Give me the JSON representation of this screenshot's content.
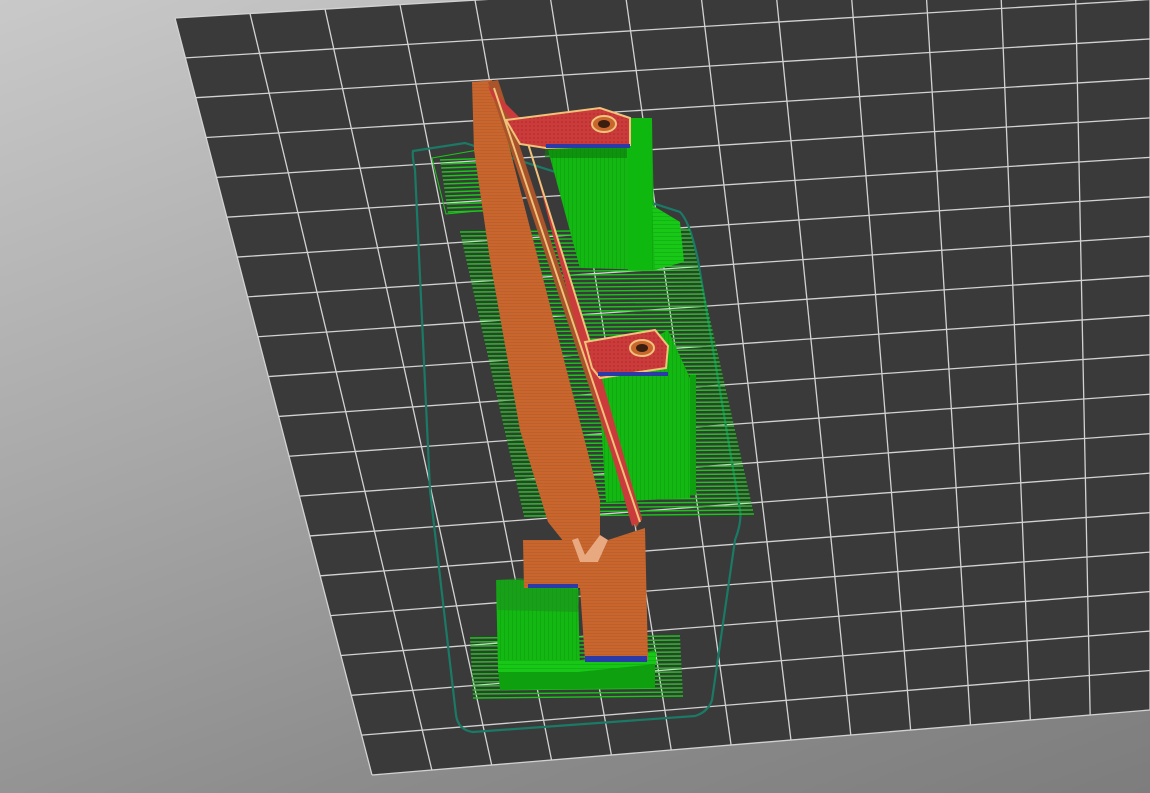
{
  "viewport": {
    "background_top": "#c9c9c9",
    "background_bottom": "#7d7d7d"
  },
  "bed": {
    "fill": "#3a3a3a",
    "grid_line": "#d2d2d2",
    "grid_divisions_u": 13,
    "grid_divisions_v": 19
  },
  "model": {
    "perimeter_color": "#c8662e",
    "perimeter_dark_color": "#a9542a",
    "top_solid_color": "#cc3b3b",
    "top_outline_color": "#f0c27a",
    "support_color": "#17c817",
    "support_dark_color": "#0fa00f",
    "support_interface_color": "#0e7a0e",
    "bridge_color": "#2a3aa8",
    "skirt_color": "#1a7a66",
    "screw_holes": 2
  }
}
